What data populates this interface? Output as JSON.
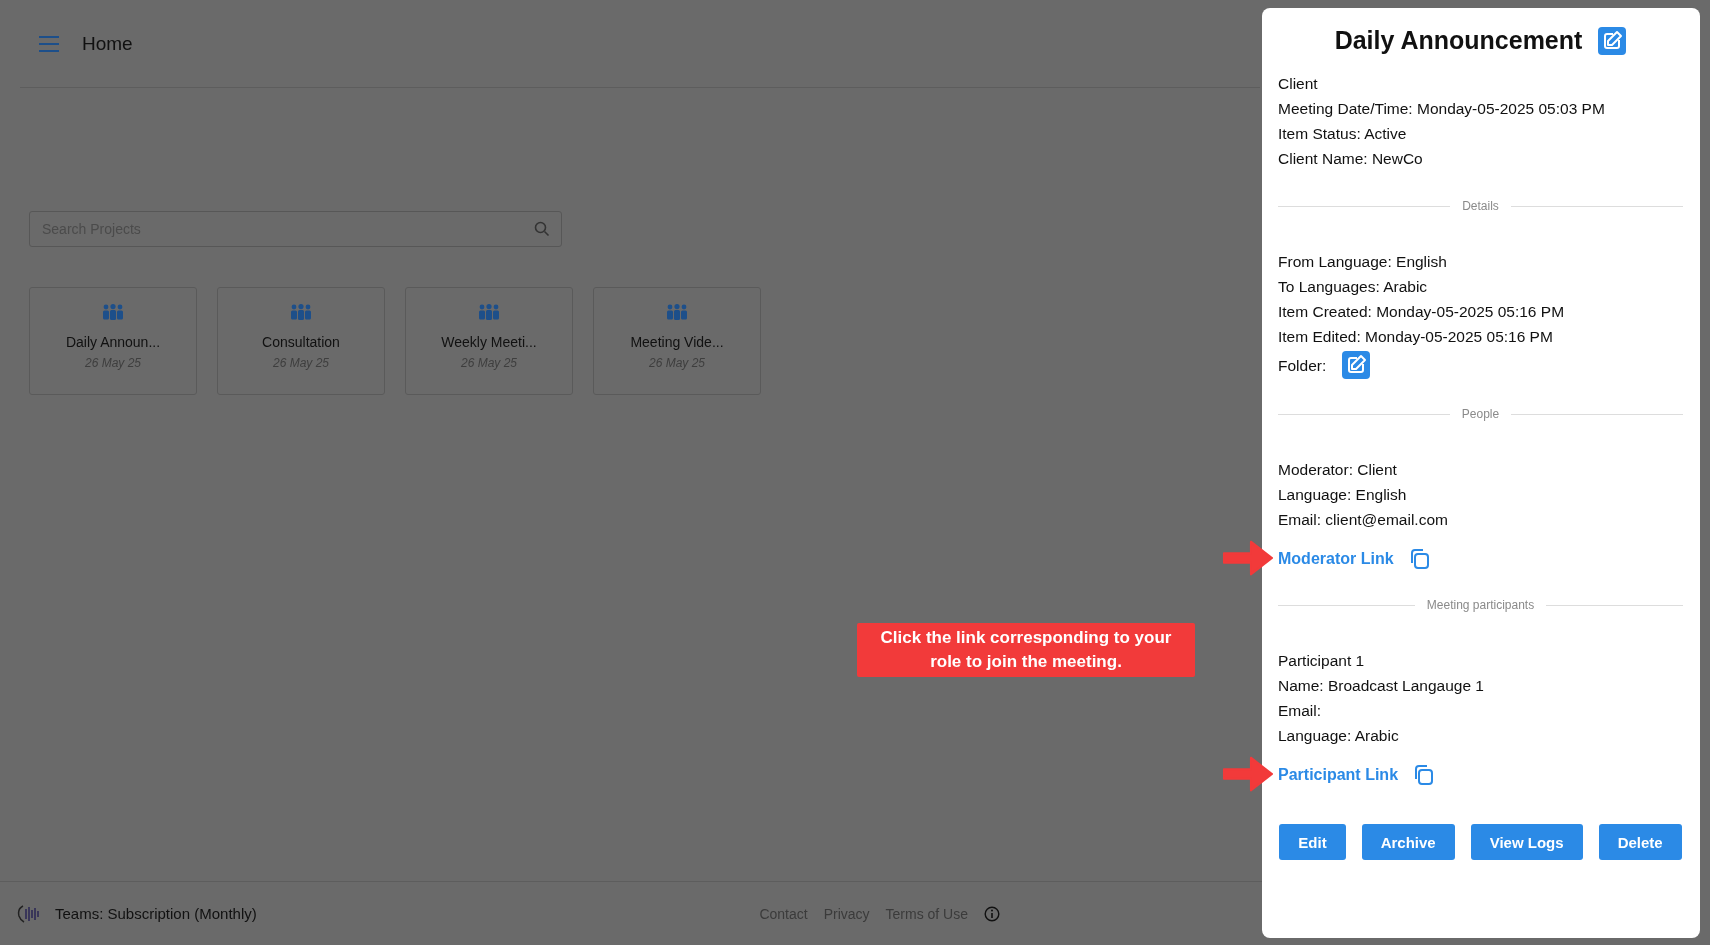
{
  "header": {
    "title": "Home"
  },
  "search": {
    "placeholder": "Search Projects"
  },
  "projects": [
    {
      "name": "Daily Announ...",
      "date": "26 May 25"
    },
    {
      "name": "Consultation",
      "date": "26 May 25"
    },
    {
      "name": "Weekly Meeti...",
      "date": "26 May 25"
    },
    {
      "name": "Meeting Vide...",
      "date": "26 May 25"
    }
  ],
  "footer": {
    "plan": "Teams: Subscription (Monthly)",
    "links": [
      "Contact",
      "Privacy",
      "Terms of Use"
    ]
  },
  "panel": {
    "title": "Daily Announcement",
    "sections": [
      {
        "kind": "lines",
        "lines": [
          "Client",
          "Meeting Date/Time: Monday-05-2025 05:03 PM",
          "Item Status: Active",
          "Client Name: NewCo"
        ]
      },
      {
        "kind": "divider",
        "label": "Details"
      },
      {
        "kind": "lines",
        "lines": [
          "From Language: English",
          "To Languages: Arabic",
          "Item Created: Monday-05-2025 05:16 PM",
          "Item Edited: Monday-05-2025 05:16 PM"
        ]
      },
      {
        "kind": "folder",
        "label": "Folder:"
      },
      {
        "kind": "divider",
        "label": "People"
      },
      {
        "kind": "lines",
        "lines": [
          "Moderator: Client",
          "Language: English",
          "Email: client@email.com"
        ]
      },
      {
        "kind": "link",
        "label": "Moderator Link",
        "annotated": true
      },
      {
        "kind": "divider",
        "label": "Meeting participants"
      },
      {
        "kind": "lines",
        "lines": [
          "Participant 1",
          "Name: Broadcast Langauge 1",
          "Email:",
          "Language: Arabic"
        ]
      },
      {
        "kind": "link",
        "label": "Participant Link",
        "annotated": true
      }
    ],
    "buttons": [
      "Edit",
      "Archive",
      "View Logs",
      "Delete"
    ]
  },
  "annotation": {
    "text": "Click the link corresponding to your role to join the meeting."
  }
}
